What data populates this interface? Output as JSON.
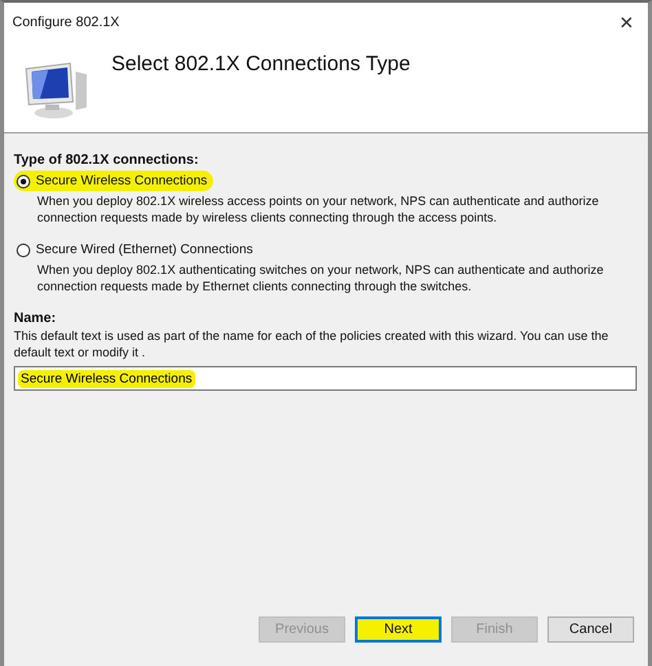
{
  "window": {
    "title": "Configure 802.1X",
    "close": "✕"
  },
  "header": {
    "title": "Select 802.1X Connections Type"
  },
  "connection_type": {
    "label": "Type of 802.1X connections:",
    "options": [
      {
        "label": "Secure Wireless Connections",
        "selected": true,
        "highlighted": true,
        "description": "When you deploy 802.1X wireless access points on your network, NPS can authenticate and authorize connection requests made by wireless clients connecting through the access points."
      },
      {
        "label": "Secure Wired (Ethernet) Connections",
        "selected": false,
        "highlighted": false,
        "description": "When you deploy 802.1X authenticating switches on your network, NPS can authenticate and authorize connection requests made by Ethernet clients connecting through the switches."
      }
    ]
  },
  "name": {
    "label": "Name:",
    "description": "This default text is used as part of the name for each of the policies created with this wizard. You can use the default text or modify it .",
    "value": "Secure Wireless Connections",
    "highlighted": true
  },
  "buttons": [
    {
      "label": "Previous",
      "disabled": true,
      "default": false,
      "highlighted": false
    },
    {
      "label": "Next",
      "disabled": false,
      "default": true,
      "highlighted": true
    },
    {
      "label": "Finish",
      "disabled": true,
      "default": false,
      "highlighted": false
    },
    {
      "label": "Cancel",
      "disabled": false,
      "default": false,
      "highlighted": false
    }
  ]
}
